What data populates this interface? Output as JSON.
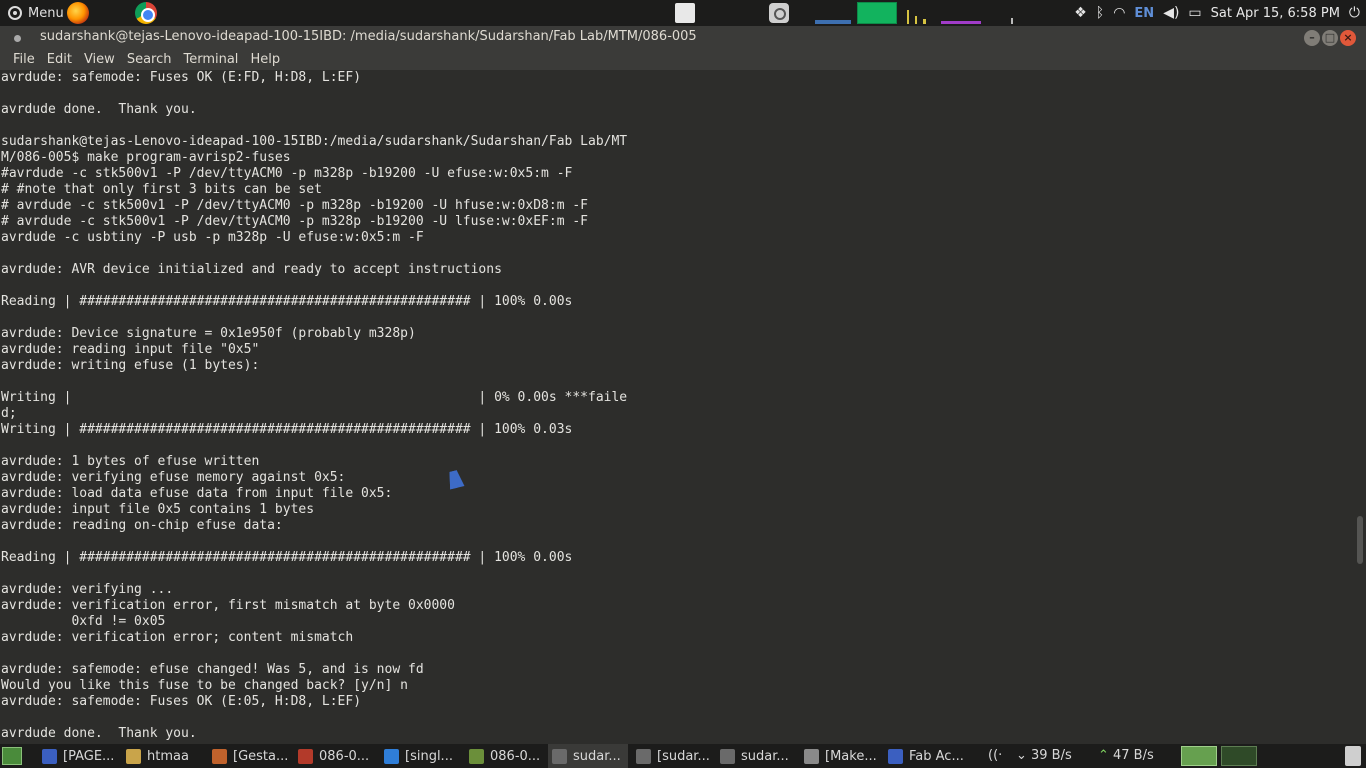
{
  "top_panel": {
    "menu_label": "Menu",
    "clock": "Sat Apr 15,  6:58 PM",
    "keyboard_layout": "EN"
  },
  "window": {
    "title": "sudarshank@tejas-Lenovo-ideapad-100-15IBD: /media/sudarshank/Sudarshan/Fab Lab/MTM/086-005",
    "buttons": {
      "minimize": "–",
      "maximize": "□",
      "close": "×"
    }
  },
  "menubar": [
    "File",
    "Edit",
    "View",
    "Search",
    "Terminal",
    "Help"
  ],
  "terminal_lines": [
    "avrdude: safemode: Fuses OK (E:FD, H:D8, L:EF)",
    "",
    "avrdude done.  Thank you.",
    "",
    "sudarshank@tejas-Lenovo-ideapad-100-15IBD:/media/sudarshank/Sudarshan/Fab Lab/MT",
    "M/086-005$ make program-avrisp2-fuses",
    "#avrdude -c stk500v1 -P /dev/ttyACM0 -p m328p -b19200 -U efuse:w:0x5:m -F",
    "# #note that only first 3 bits can be set",
    "# avrdude -c stk500v1 -P /dev/ttyACM0 -p m328p -b19200 -U hfuse:w:0xD8:m -F",
    "# avrdude -c stk500v1 -P /dev/ttyACM0 -p m328p -b19200 -U lfuse:w:0xEF:m -F",
    "avrdude -c usbtiny -P usb -p m328p -U efuse:w:0x5:m -F",
    "",
    "avrdude: AVR device initialized and ready to accept instructions",
    "",
    "Reading | ################################################## | 100% 0.00s",
    "",
    "avrdude: Device signature = 0x1e950f (probably m328p)",
    "avrdude: reading input file \"0x5\"",
    "avrdude: writing efuse (1 bytes):",
    "",
    "Writing |                                                    | 0% 0.00s ***faile",
    "d;",
    "Writing | ################################################## | 100% 0.03s",
    "",
    "avrdude: 1 bytes of efuse written",
    "avrdude: verifying efuse memory against 0x5:",
    "avrdude: load data efuse data from input file 0x5:",
    "avrdude: input file 0x5 contains 1 bytes",
    "avrdude: reading on-chip efuse data:",
    "",
    "Reading | ################################################## | 100% 0.00s",
    "",
    "avrdude: verifying ...",
    "avrdude: verification error, first mismatch at byte 0x0000",
    "         0xfd != 0x05",
    "avrdude: verification error; content mismatch",
    "",
    "avrdude: safemode: efuse changed! Was 5, and is now fd",
    "Would you like this fuse to be changed back? [y/n] n",
    "avrdude: safemode: Fuses OK (E:05, H:D8, L:EF)",
    "",
    "avrdude done.  Thank you."
  ],
  "taskbar": [
    {
      "label": "[PAGE...",
      "icon_color": "#3b5fc0",
      "icon": "chrome-icon"
    },
    {
      "label": "htmaa",
      "icon_color": "#c9a44a",
      "icon": "folder-icon"
    },
    {
      "label": "[Gesta...",
      "icon_color": "#c0622c",
      "icon": "e-app-icon"
    },
    {
      "label": "086-0...",
      "icon_color": "#b33a2a",
      "icon": "doc-icon"
    },
    {
      "label": "[singl...",
      "icon_color": "#2f7ed8",
      "icon": "vscode-icon"
    },
    {
      "label": "086-0...",
      "icon_color": "#6b8f3a",
      "icon": "doc-icon"
    },
    {
      "label": "sudar...",
      "icon_color": "#6a6a6a",
      "icon": "terminal-icon"
    },
    {
      "label": "[sudar...",
      "icon_color": "#6a6a6a",
      "icon": "terminal-icon"
    },
    {
      "label": "sudar...",
      "icon_color": "#6a6a6a",
      "icon": "terminal-icon"
    },
    {
      "label": "[Make...",
      "icon_color": "#8a8a8a",
      "icon": "editor-icon"
    },
    {
      "label": "Fab Ac...",
      "icon_color": "#3b5fc0",
      "icon": "chrome-icon"
    }
  ],
  "network": {
    "down": "39 B/s",
    "up": "47 B/s"
  },
  "colors": {
    "terminal_bg": "#2d2d2b",
    "terminal_fg": "#e4e3df",
    "panel_bg": "#1c1c1b",
    "accent_green": "#66a04f"
  }
}
